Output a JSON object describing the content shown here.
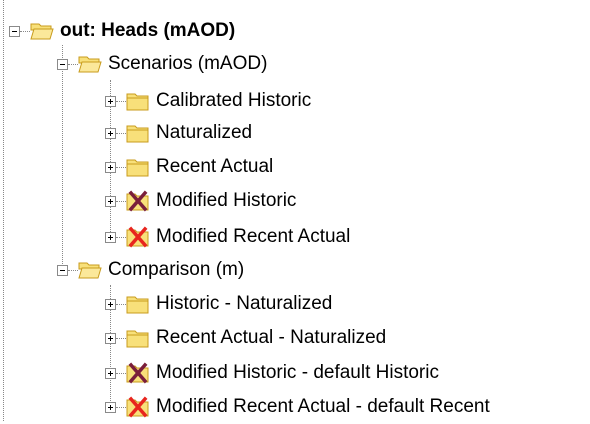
{
  "tree": {
    "root": {
      "label": "out: Heads (mAOD)",
      "icon": "folder-open-icon",
      "expanded": true
    },
    "groups": [
      {
        "label": "Scenarios (mAOD)",
        "icon": "folder-open-icon",
        "expanded": true,
        "items": [
          {
            "label": "Calibrated Historic",
            "icon": "folder-icon"
          },
          {
            "label": "Naturalized",
            "icon": "folder-icon"
          },
          {
            "label": "Recent Actual",
            "icon": "folder-icon"
          },
          {
            "label": "Modified Historic",
            "icon": "folder-cross-dark-icon"
          },
          {
            "label": "Modified Recent Actual",
            "icon": "folder-cross-red-icon"
          }
        ]
      },
      {
        "label": "Comparison (m)",
        "icon": "folder-open-icon",
        "expanded": true,
        "items": [
          {
            "label": "Historic - Naturalized",
            "icon": "folder-icon"
          },
          {
            "label": "Recent Actual - Naturalized",
            "icon": "folder-icon"
          },
          {
            "label": "Modified Historic - default Historic",
            "icon": "folder-cross-dark-icon"
          },
          {
            "label": "Modified Recent Actual - default Recent",
            "icon": "folder-cross-red-icon"
          }
        ]
      }
    ]
  },
  "colors": {
    "folder_fill": "#f8e07a",
    "folder_stroke": "#c89b1c",
    "cross_dark": "#7a1e3a",
    "cross_red": "#e8251e"
  }
}
